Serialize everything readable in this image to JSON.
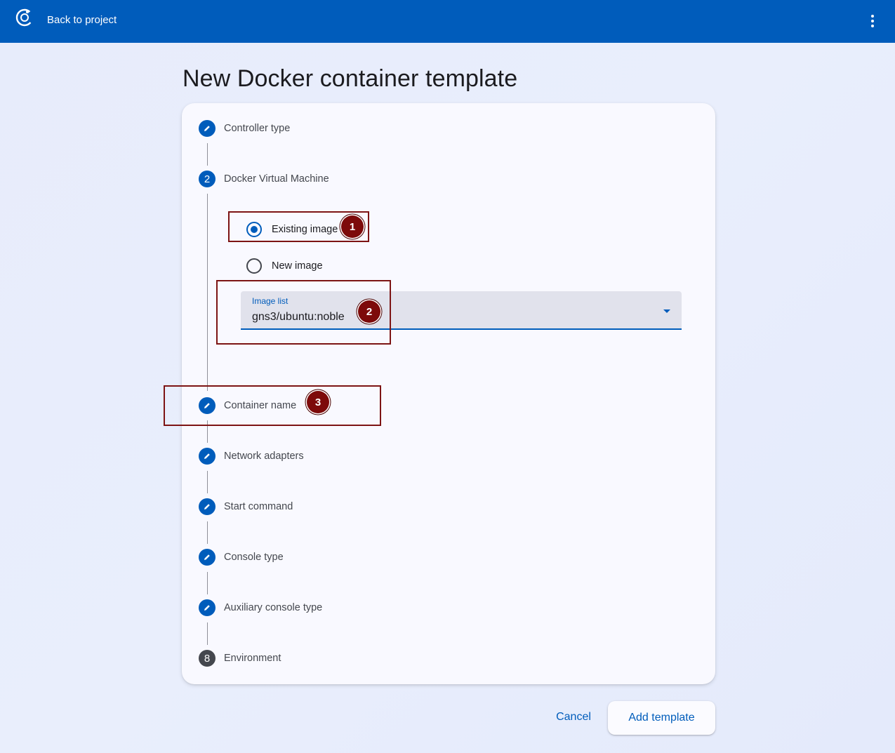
{
  "topbar": {
    "back_label": "Back to project",
    "logo_icon": "gns3-logo-icon",
    "menu_icon": "more-vert-icon"
  },
  "page": {
    "title": "New Docker container template"
  },
  "stepper": {
    "steps": [
      {
        "label": "Controller type",
        "indicator": "edit",
        "state": "done"
      },
      {
        "label": "Docker Virtual Machine",
        "indicator": "2",
        "state": "active"
      },
      {
        "label": "Container name",
        "indicator": "edit",
        "state": "done"
      },
      {
        "label": "Network adapters",
        "indicator": "edit",
        "state": "done"
      },
      {
        "label": "Start command",
        "indicator": "edit",
        "state": "done"
      },
      {
        "label": "Console type",
        "indicator": "edit",
        "state": "done"
      },
      {
        "label": "Auxiliary console type",
        "indicator": "edit",
        "state": "done"
      },
      {
        "label": "Environment",
        "indicator": "8",
        "state": "pending"
      }
    ]
  },
  "docker_vm": {
    "options": [
      {
        "label": "Existing image",
        "checked": true
      },
      {
        "label": "New image",
        "checked": false
      }
    ],
    "image_list": {
      "label": "Image list",
      "value": "gns3/ubuntu:noble"
    }
  },
  "annotations": {
    "badges": [
      "1",
      "2",
      "3"
    ],
    "color": "#7d0a0a"
  },
  "actions": {
    "cancel_label": "Cancel",
    "add_label": "Add template"
  },
  "colors": {
    "primary": "#005cbb",
    "background": "#e7ecfb",
    "card": "#f9f9ff"
  }
}
